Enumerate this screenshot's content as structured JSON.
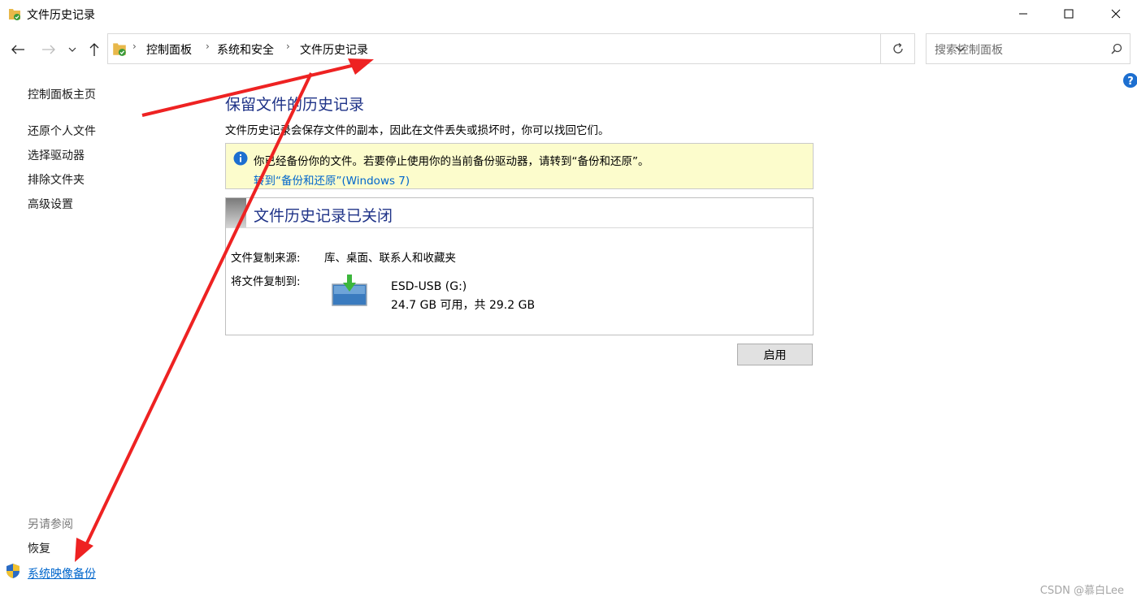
{
  "window": {
    "title": "文件历史记录"
  },
  "breadcrumb": [
    "控制面板",
    "系统和安全",
    "文件历史记录"
  ],
  "search": {
    "placeholder": "搜索控制面板"
  },
  "sidebar": {
    "home": "控制面板主页",
    "items": [
      "还原个人文件",
      "选择驱动器",
      "排除文件夹",
      "高级设置"
    ],
    "see_also_header": "另请参阅",
    "see_also": [
      "恢复",
      "系统映像备份"
    ]
  },
  "main": {
    "title": "保留文件的历史记录",
    "description": "文件历史记录会保存文件的副本，因此在文件丢失或损坏时，你可以找回它们。",
    "info": {
      "message": "你已经备份你的文件。若要停止使用你的当前备份驱动器，请转到“备份和还原”。",
      "link": "转到“备份和还原”(Windows 7)"
    },
    "status": {
      "title": "文件历史记录已关闭",
      "source_label": "文件复制来源:",
      "source_value": "库、桌面、联系人和收藏夹",
      "dest_label": "将文件复制到:",
      "drive_name": "ESD-USB (G:)",
      "drive_space": "24.7 GB 可用，共 29.2 GB"
    },
    "enable_label": "启用"
  },
  "watermark": "CSDN @慕白Lee",
  "colors": {
    "heading_blue": "#1e3287",
    "link_blue": "#0066cc",
    "info_bg": "#fcfccc",
    "annotation_red": "#ee2222"
  },
  "icons": [
    "file-history-icon",
    "minimize-icon",
    "maximize-icon",
    "close-icon",
    "back-arrow-icon",
    "forward-arrow-icon",
    "recent-chevron-icon",
    "up-arrow-icon",
    "address-dropdown-icon",
    "refresh-icon",
    "search-icon",
    "help-icon",
    "info-icon",
    "drive-icon",
    "shield-icon"
  ]
}
